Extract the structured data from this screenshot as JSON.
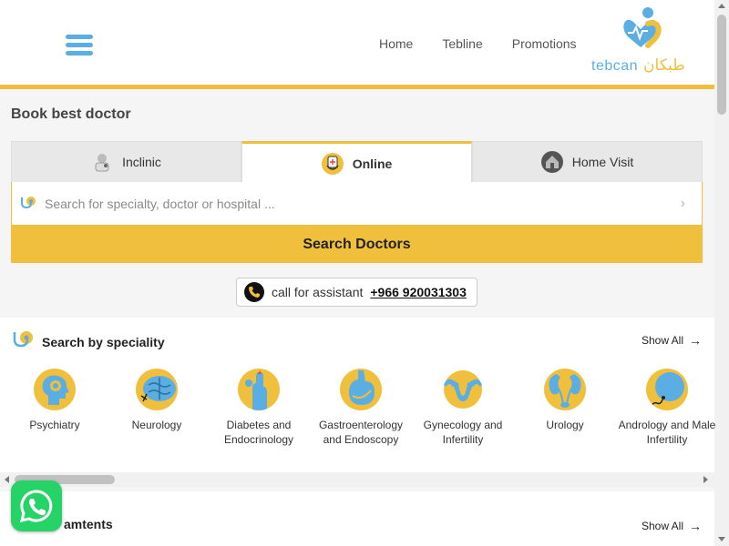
{
  "header": {
    "nav": [
      "Home",
      "Tebline",
      "Promotions"
    ],
    "logo_text": "tebcan",
    "logo_arabic": "طبكان"
  },
  "booking": {
    "title": "Book best doctor",
    "tabs": [
      {
        "label": "Inclinic",
        "icon": "doctor-icon"
      },
      {
        "label": "Online",
        "icon": "online-consult-icon",
        "active": true
      },
      {
        "label": "Home Visit",
        "icon": "home-icon"
      }
    ],
    "search_placeholder": "Search for specialty, doctor or hospital ...",
    "search_button": "Search Doctors",
    "call_label": "call for assistant",
    "call_number": "+966 920031303"
  },
  "speciality": {
    "title": "Search by speciality",
    "show_all": "Show All",
    "items": [
      {
        "label": "Psychiatry",
        "icon": "psychiatry-icon"
      },
      {
        "label": "Neurology",
        "icon": "brain-icon"
      },
      {
        "label": "Diabetes and Endocrinology",
        "icon": "diabetes-icon"
      },
      {
        "label": "Gastroenterology and Endoscopy",
        "icon": "stomach-icon"
      },
      {
        "label": "Gynecology and Infertility",
        "icon": "uterus-icon"
      },
      {
        "label": "Urology",
        "icon": "kidney-icon"
      },
      {
        "label": "Andrology and Male Infertility",
        "icon": "sperm-icon"
      }
    ]
  },
  "treatments": {
    "title": "amtents",
    "show_all": "Show All"
  },
  "colors": {
    "accent": "#f0bf3c",
    "brand_blue": "#5aaee4",
    "whatsapp": "#25d366"
  }
}
